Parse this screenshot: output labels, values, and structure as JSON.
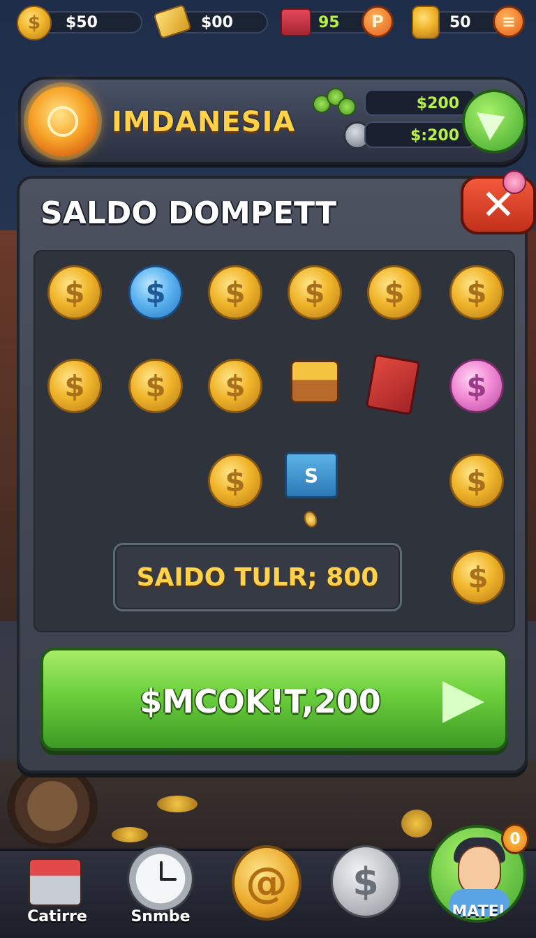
{
  "topbar": {
    "coins": "$50",
    "gold_bars": "$00",
    "gift": "95",
    "p_button": "P",
    "stack": "50",
    "menu_icon": "≡"
  },
  "header": {
    "title": "IMDANESIA",
    "value_top": "$200",
    "value_bottom": "$:200"
  },
  "dialog": {
    "title": "SALDO DOMPETT",
    "close": "✕",
    "total": "SAIDO TULR; 800",
    "action_label": "$MCOK!T,200",
    "box_letter": "S",
    "coin_symbol": "$"
  },
  "nav": {
    "left_label": "Catirre",
    "second_label": "Snmbe",
    "center_symbol": "@",
    "fourth_symbol": "$",
    "profile_label": "MATEL",
    "profile_badge": "0"
  },
  "colors": {
    "accent_gold": "#ffd24a",
    "accent_green": "#6bcf3c",
    "close_red": "#e24a2e"
  }
}
